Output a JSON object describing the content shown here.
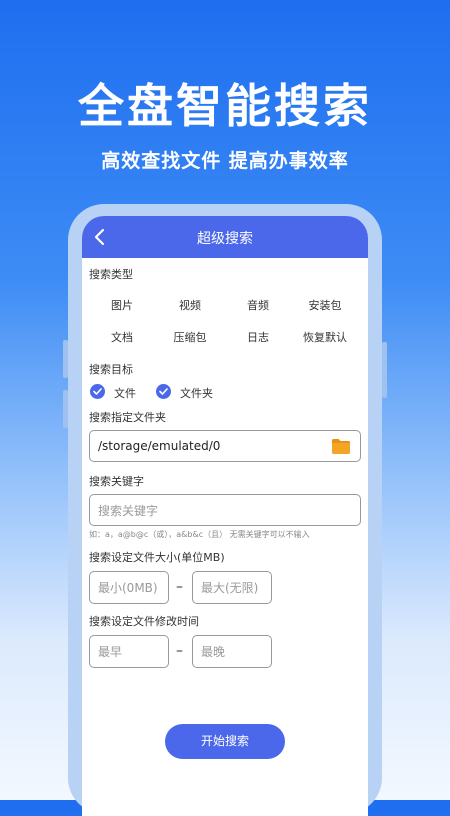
{
  "promo": {
    "headline": "全盘智能搜索",
    "subline": "高效查找文件 提高办事效率"
  },
  "appbar": {
    "title": "超级搜索",
    "back_icon": "chevron-left-icon"
  },
  "search_type": {
    "label": "搜索类型",
    "options": [
      "图片",
      "视频",
      "音频",
      "安装包",
      "文档",
      "压缩包",
      "日志",
      "恢复默认"
    ]
  },
  "search_target": {
    "label": "搜索目标",
    "options": [
      {
        "label": "文件",
        "checked": true
      },
      {
        "label": "文件夹",
        "checked": true
      }
    ]
  },
  "folder": {
    "label": "搜索指定文件夹",
    "value": "/storage/emulated/0",
    "icon": "folder-icon"
  },
  "keyword": {
    "label": "搜索关键字",
    "placeholder": "搜索关键字",
    "hint": "如：a，a@b@c（或），a&b&c（且）  无需关键字可以不输入"
  },
  "size": {
    "label": "搜索设定文件大小(单位MB)",
    "min_placeholder": "最小(0MB)",
    "max_placeholder": "最大(无限)",
    "separator": "–"
  },
  "time": {
    "label": "搜索设定文件修改时间",
    "start_placeholder": "最早",
    "end_placeholder": "最晚",
    "separator": "–"
  },
  "start_button": {
    "label": "开始搜索"
  },
  "colors": {
    "accent": "#4c68ea",
    "folder": "#f5a524"
  }
}
